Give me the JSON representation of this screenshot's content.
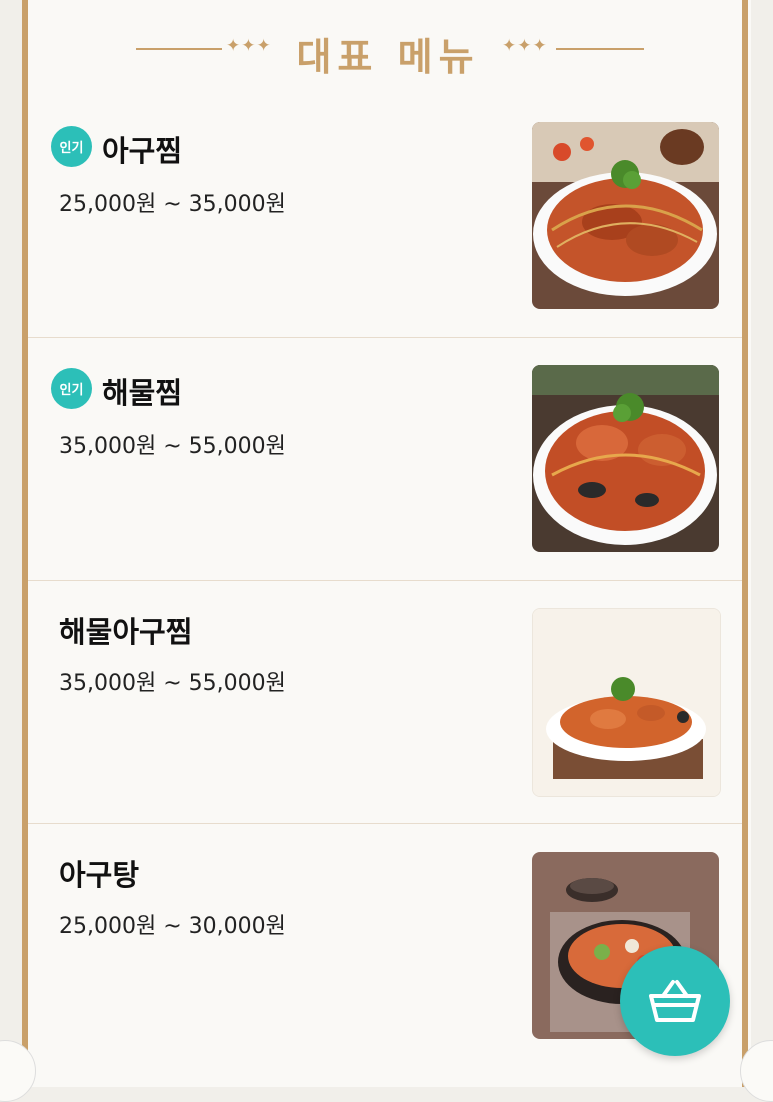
{
  "header": {
    "title": "대표 메뉴",
    "ornament": "✦✦✦"
  },
  "menu": [
    {
      "name": "아구찜",
      "badge": "인기",
      "price": "25,000원 ~ 35,000원",
      "image": "braised-monkfish-photo"
    },
    {
      "name": "해물찜",
      "badge": "인기",
      "price": "35,000원 ~ 55,000원",
      "image": "braised-seafood-photo"
    },
    {
      "name": "해물아구찜",
      "badge": "",
      "price": "35,000원 ~ 55,000원",
      "image": "braised-seafood-monkfish-photo"
    },
    {
      "name": "아구탕",
      "badge": "",
      "price": "25,000원 ~ 30,000원",
      "image": "monkfish-stew-photo"
    }
  ],
  "cart": {
    "icon": "shopping-basket-icon"
  },
  "colors": {
    "accent": "#c9a06a",
    "teal": "#2cbfb8",
    "divider": "#e7dccd"
  }
}
